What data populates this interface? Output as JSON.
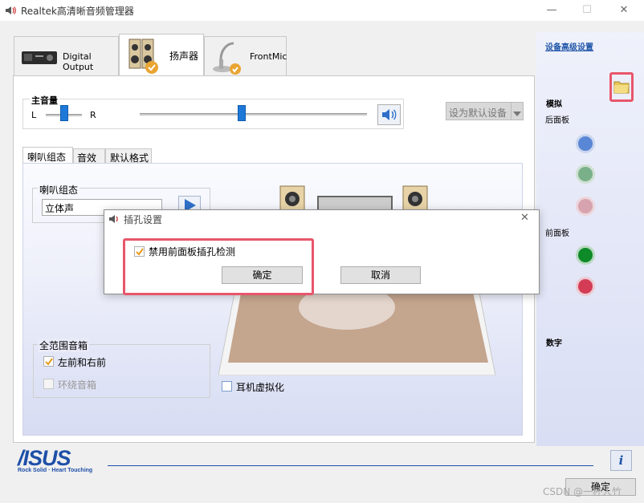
{
  "window": {
    "title": "Realtek高清晰音频管理器",
    "controls": [
      "—",
      "☐",
      "✕"
    ]
  },
  "device_tabs": [
    {
      "label": "Digital Output",
      "active": false
    },
    {
      "label": "扬声器",
      "active": true
    },
    {
      "label": "FrontMic",
      "active": false
    }
  ],
  "volume": {
    "group_label": "主音量",
    "left_label": "L",
    "right_label": "R",
    "balance_level": 0.5,
    "volume_level": 0.45,
    "default_device_label": "设为默认设备"
  },
  "sub_tabs": [
    "喇叭组态",
    "音效",
    "默认格式"
  ],
  "speaker_config": {
    "group_label": "喇叭组态",
    "selected": "立体声"
  },
  "full_range": {
    "group_label": "全范围音箱",
    "front_label": "左前和右前",
    "front_checked": true,
    "surround_label": "环绕音箱",
    "surround_checked": false
  },
  "headphone_virtualization": {
    "label": "耳机虚拟化",
    "checked": false
  },
  "right_panel": {
    "advanced_link": "设备高级设置",
    "analog_label": "模拟",
    "back_panel_label": "后面板",
    "front_panel_label": "前面板",
    "digital_label": "数字",
    "colors": {
      "back_blue": "#5a86d6",
      "back_green": "#79b08a",
      "back_pink": "#d7a3ae",
      "front_green": "#0e8a28",
      "front_red": "#d43c56"
    }
  },
  "dialog": {
    "title": "插孔设置",
    "checkbox_label": "禁用前面板插孔检测",
    "checkbox_checked": true,
    "ok_label": "确定",
    "cancel_label": "取消",
    "close_glyph": "✕"
  },
  "footer": {
    "brand": "/ISUS",
    "tagline": "Rock Solid · Heart Touching",
    "info_glyph": "i",
    "ok_label": "确定",
    "watermark": "CSDN @一杯人竹"
  },
  "accent_color": "#1e78d7",
  "highlight_color": "#e8566b"
}
